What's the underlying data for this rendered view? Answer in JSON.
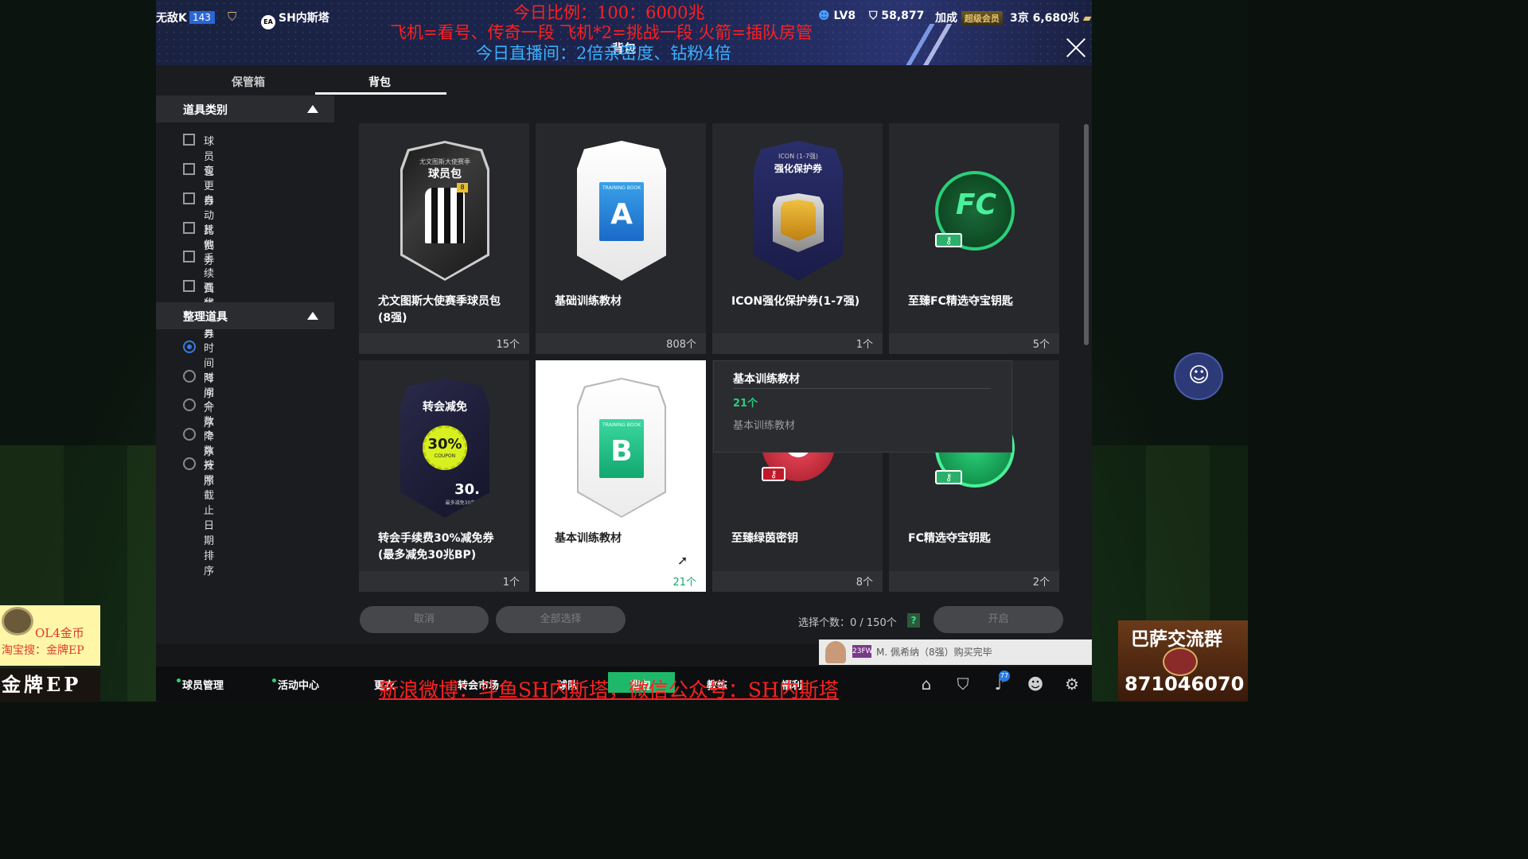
{
  "overlay": {
    "line1": "今日比例：100：6000兆",
    "line2": "飞机=看号、传奇一段  飞机*2=挑战一段  火箭=插队房管",
    "line3": "今日直播间：2倍亲密度、钻粉4倍",
    "bottom": "新浪微博：斗鱼SH内斯塔，微信公众号：SH内斯塔"
  },
  "header": {
    "user_name": "无敌K",
    "level": "143",
    "team_name": "SH内斯塔",
    "account_level": "LV8",
    "coins": "58,877",
    "boost_label": "加成",
    "vip_label": "超级会员",
    "bp": "3京 6,680兆",
    "title": "背包"
  },
  "tabs": [
    "保管箱",
    "背包"
  ],
  "sidebar": {
    "section1": "道具类别",
    "categories": [
      "球员包",
      "变更券",
      "自动比赛券",
      "其他",
      "手续费减免券",
      "强化道具"
    ],
    "section2": "整理道具",
    "sort_options": [
      "时间降序",
      "时间升序",
      "个数降序",
      "个数升序",
      "按照截止日期排序"
    ],
    "selected_sort": "时间降序"
  },
  "items": [
    {
      "name": "尤文图斯大使赛季球员包\n(8强)",
      "name1": "尤文图斯大使赛季球员包",
      "name2": "(8强)",
      "count": "15个",
      "pack_top": "尤文图斯大使赛季",
      "pack_title": "球员包",
      "pack_level": "8"
    },
    {
      "name1": "基础训练教材",
      "name2": "",
      "count": "808个",
      "book_letter": "A",
      "book_label": "TRAINING BOOK"
    },
    {
      "name1": "ICON强化保护券(1-7强)",
      "name2": "",
      "count": "1个",
      "pack_top": "ICON (1-7强)",
      "pack_title": "强化保护券"
    },
    {
      "name1": "至臻FC精选夺宝钥匙",
      "name2": "",
      "count": "5个"
    },
    {
      "name1": "转会手续费30%减免券",
      "name2": "(最多减免30兆BP)",
      "count": "1个",
      "pack_title": "转会减免",
      "coupon": "30%",
      "coupon_sub": "COUPON",
      "pack_num": "30.",
      "pack_note": "最多减免30兆BP"
    },
    {
      "name1": "基本训练教材",
      "name2": "",
      "count": "21个",
      "book_letter": "B",
      "book_label": "TRAINING BOOK"
    },
    {
      "name1": "至臻绿茵密钥",
      "name2": "",
      "count": "8个"
    },
    {
      "name1": "FC精选夺宝钥匙",
      "name2": "",
      "count": "2个"
    }
  ],
  "tooltip": {
    "title": "基本训练教材",
    "count": "21个",
    "desc": "基本训练教材"
  },
  "actions": {
    "cancel": "取消",
    "select_all": "全部选择",
    "selected": "选择个数：0 / 150个",
    "help": "?",
    "open": "开启"
  },
  "news": {
    "badge": "23FW",
    "text": "M. 佩希纳（8强）购买完毕"
  },
  "bottom_nav": [
    "球员管理",
    "活动中心",
    "更衣",
    "转会市场",
    "球队",
    "背包",
    "教练",
    "福利"
  ],
  "bell_count": "77",
  "widgets": {
    "left1": "OL4金币",
    "left2": "淘宝搜：金牌EP",
    "left_brand": "金牌EP",
    "right_title": "巴萨交流群",
    "right_number": "871046070"
  },
  "colors": {
    "accent_green": "#27d07a",
    "selected_radio": "#3a7ae0",
    "overlay_red": "#ff2020",
    "overlay_blue": "#3bb0ff"
  }
}
